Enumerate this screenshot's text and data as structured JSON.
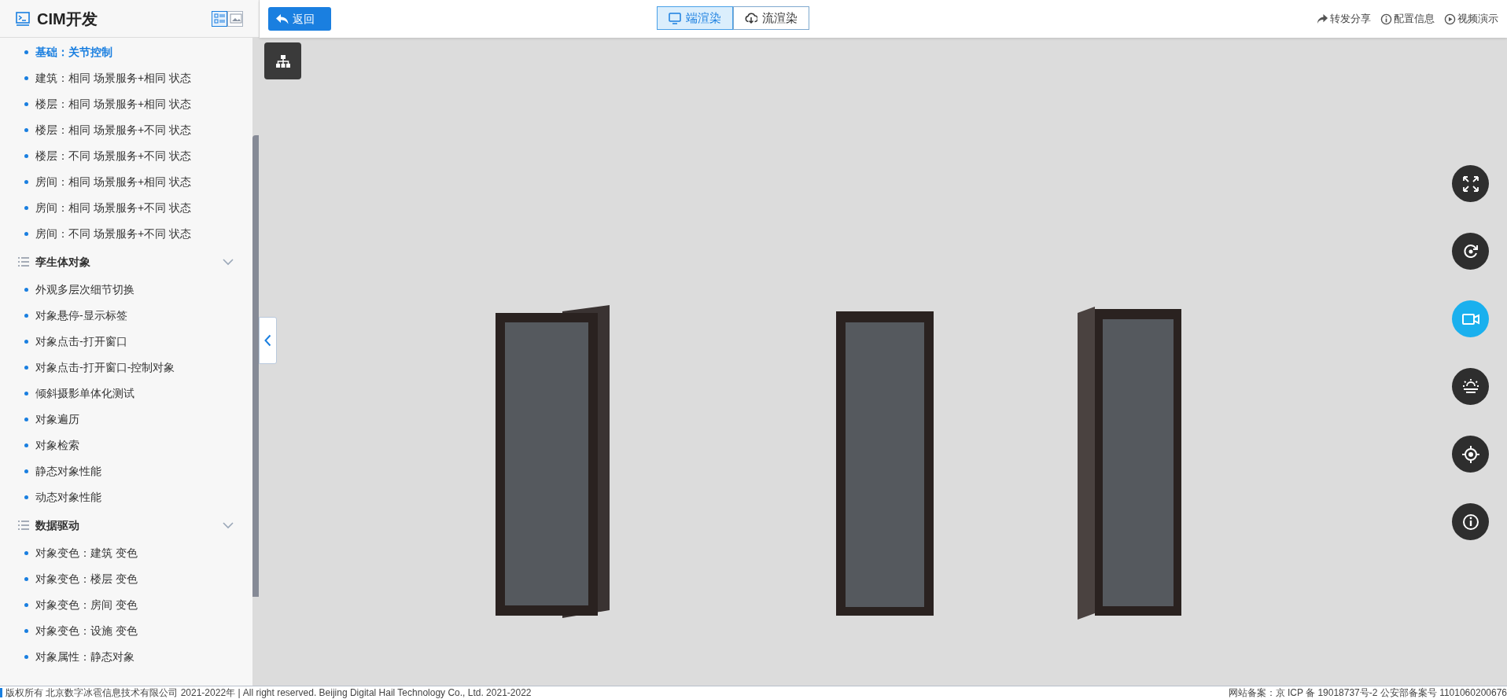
{
  "sidebar": {
    "title": "CIM开发",
    "view_toggles": [
      {
        "kind": "list",
        "selected": true
      },
      {
        "kind": "image",
        "selected": false
      }
    ],
    "sections": [
      {
        "items": [
          {
            "label": "基础：关节控制",
            "selected": true
          },
          {
            "label": "建筑：相同 场景服务+相同 状态",
            "selected": false
          },
          {
            "label": "楼层：相同 场景服务+相同 状态",
            "selected": false
          },
          {
            "label": "楼层：相同 场景服务+不同 状态",
            "selected": false
          },
          {
            "label": "楼层：不同 场景服务+不同 状态",
            "selected": false
          },
          {
            "label": "房间：相同 场景服务+相同 状态",
            "selected": false
          },
          {
            "label": "房间：相同 场景服务+不同 状态",
            "selected": false
          },
          {
            "label": "房间：不同 场景服务+不同 状态",
            "selected": false
          }
        ]
      },
      {
        "title": "孪生体对象",
        "expanded": true,
        "items": [
          {
            "label": "外观多层次细节切换",
            "selected": false
          },
          {
            "label": "对象悬停-显示标签",
            "selected": false
          },
          {
            "label": "对象点击-打开窗口",
            "selected": false
          },
          {
            "label": "对象点击-打开窗口-控制对象",
            "selected": false
          },
          {
            "label": "倾斜摄影单体化测试",
            "selected": false
          },
          {
            "label": "对象遍历",
            "selected": false
          },
          {
            "label": "对象检索",
            "selected": false
          },
          {
            "label": "静态对象性能",
            "selected": false
          },
          {
            "label": "动态对象性能",
            "selected": false
          }
        ]
      },
      {
        "title": "数据驱动",
        "expanded": true,
        "items": [
          {
            "label": "对象变色：建筑 变色",
            "selected": false
          },
          {
            "label": "对象变色：楼层 变色",
            "selected": false
          },
          {
            "label": "对象变色：房间 变色",
            "selected": false
          },
          {
            "label": "对象变色：设施 变色",
            "selected": false
          },
          {
            "label": "对象属性：静态对象",
            "selected": false
          }
        ]
      }
    ]
  },
  "toolbar": {
    "back": "返回",
    "render_modes": [
      {
        "label": "端渲染",
        "kind": "screen",
        "selected": true
      },
      {
        "label": "流渲染",
        "kind": "cloud",
        "selected": false
      }
    ],
    "links": [
      {
        "label": "转发分享",
        "kind": "share"
      },
      {
        "label": "配置信息",
        "kind": "info"
      },
      {
        "label": "视频演示",
        "kind": "play"
      }
    ]
  },
  "viewport": {
    "side_buttons": [
      {
        "kind": "fullscreen",
        "selected": false
      },
      {
        "kind": "refresh",
        "selected": false
      },
      {
        "kind": "camera",
        "selected": true
      },
      {
        "kind": "weather",
        "selected": false
      },
      {
        "kind": "locate",
        "selected": false
      },
      {
        "kind": "info",
        "selected": false
      }
    ]
  },
  "footer": {
    "copyright": "版权所有 北京数字冰雹信息技术有限公司 2021-2022年 | All right reserved. Beijing Digital Hail Technology Co., Ltd. 2021-2022",
    "record": "网站备案：京 ICP 备 19018737号-2 公安部备案号 1101060200676"
  }
}
